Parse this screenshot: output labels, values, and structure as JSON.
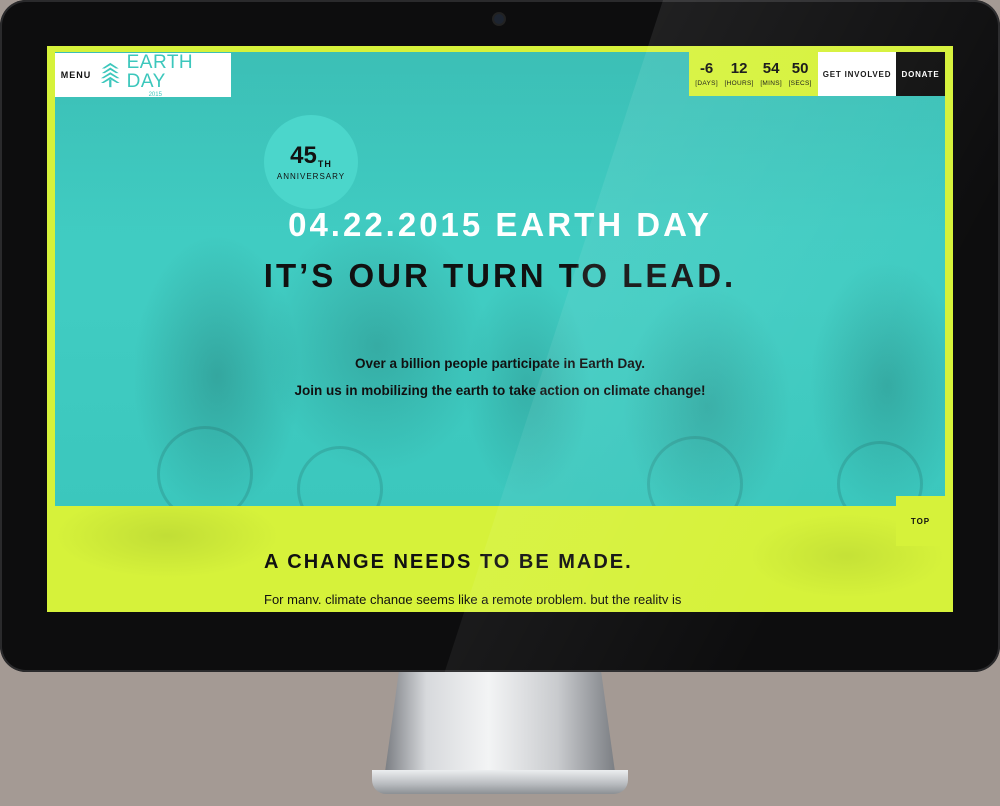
{
  "nav": {
    "menu_label": "MENU",
    "logo_title": "EARTH DAY",
    "logo_year": "2015",
    "get_involved_label": "GET INVOLVED",
    "donate_label": "DONATE"
  },
  "countdown": [
    {
      "value": "-6",
      "label": "[DAYS]"
    },
    {
      "value": "12",
      "label": "[HOURS]"
    },
    {
      "value": "54",
      "label": "[MINS]"
    },
    {
      "value": "50",
      "label": "[SECS]"
    }
  ],
  "hero": {
    "badge_number": "45",
    "badge_suffix": "TH",
    "badge_label": "ANNIVERSARY",
    "headline_1": "04.22.2015 EARTH DAY",
    "headline_2": "IT’S OUR TURN TO LEAD.",
    "sub_1": "Over a billion people participate in Earth Day.",
    "sub_2": "Join us in mobilizing the earth to take action on climate change!"
  },
  "section": {
    "title": "A CHANGE NEEDS TO BE MADE.",
    "body": "For many, climate change seems like a remote problem, but the reality is"
  },
  "top_label": "TOP",
  "colors": {
    "lime": "#d6f23a",
    "teal": "#3fcac0",
    "badge_teal": "#4bd6cb",
    "logo_teal": "#3cc7bc",
    "black": "#111111"
  }
}
